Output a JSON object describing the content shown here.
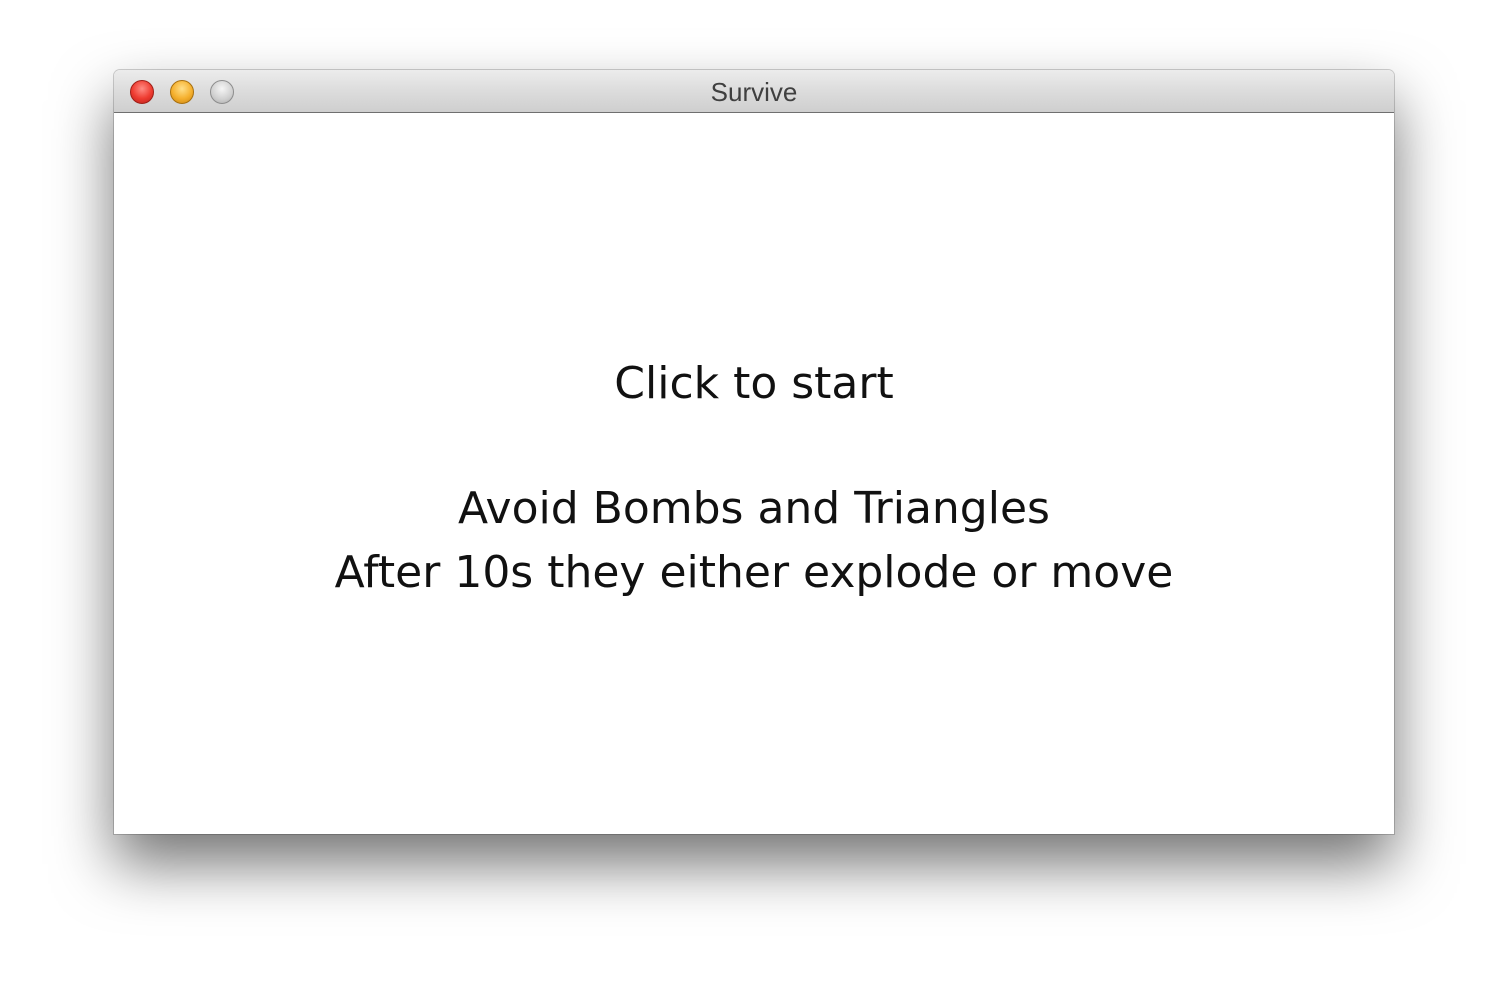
{
  "window": {
    "title": "Survive",
    "controls": {
      "close": "close-icon",
      "minimize": "minimize-icon",
      "zoom": "zoom-icon"
    }
  },
  "game": {
    "start_prompt": "Click to start",
    "instructions": [
      "Avoid Bombs and Triangles",
      "After 10s they either explode or move"
    ]
  },
  "colors": {
    "close": "#ee3b30",
    "minimize": "#f5b02e",
    "zoom": "#cfcfcf",
    "text": "#111111",
    "background": "#ffffff"
  }
}
